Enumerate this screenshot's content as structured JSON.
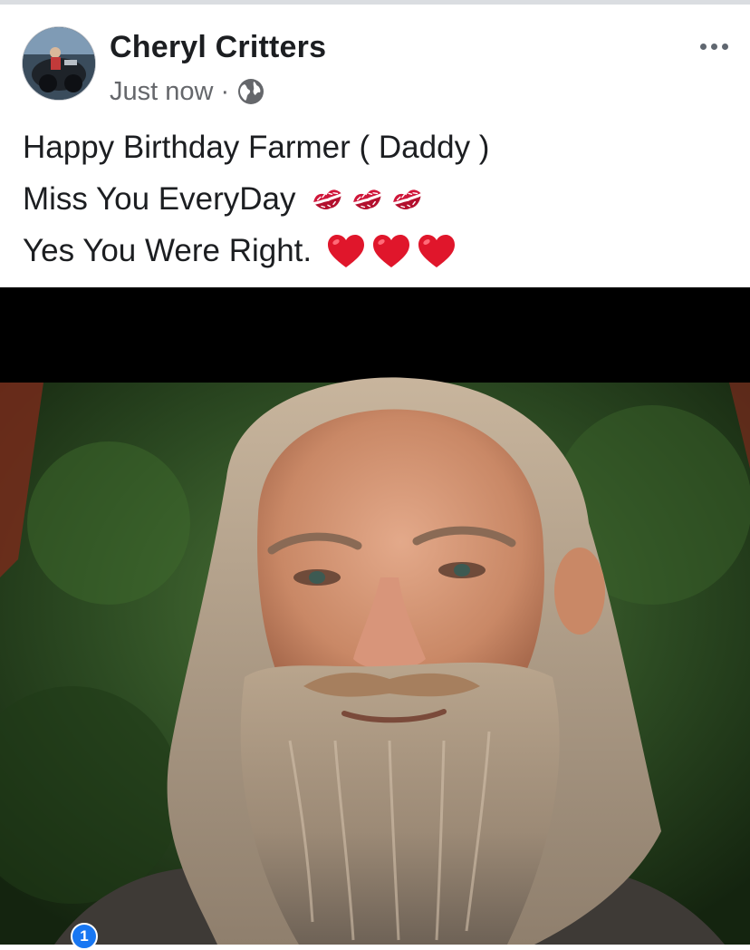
{
  "post": {
    "author": "Cheryl Critters",
    "timestamp": "Just now",
    "separator": "·",
    "privacy_icon": "globe-icon",
    "menu_icon": "more-options-icon",
    "message_lines": [
      "Happy Birthday Farmer ( Daddy )",
      "Miss You EveryDay",
      "Yes You Were Right."
    ],
    "line2_emojis": [
      "kiss-mark-icon",
      "kiss-mark-icon",
      "kiss-mark-icon"
    ],
    "line3_emojis": [
      "red-heart-icon",
      "red-heart-icon",
      "red-heart-icon"
    ],
    "photo_subject": "bearded-man-portrait",
    "notification_badge": "1"
  },
  "colors": {
    "author_text": "#1c1e21",
    "meta_text": "#65676b",
    "kiss": "#d0163a",
    "heart": "#e0162b",
    "badge": "#1877f2"
  }
}
